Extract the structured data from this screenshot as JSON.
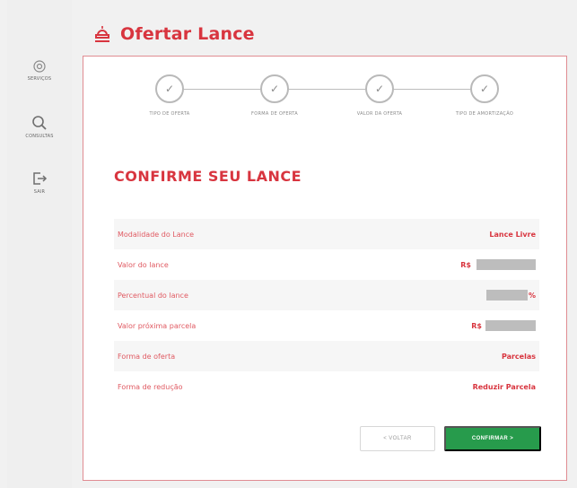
{
  "sidebar": {
    "items": [
      {
        "label": "SERVIÇOS"
      },
      {
        "label": "CONSULTAS"
      },
      {
        "label": "SAIR"
      }
    ]
  },
  "header": {
    "title": "Ofertar Lance"
  },
  "stepper": {
    "steps": [
      {
        "label": "TIPO DE OFERTA"
      },
      {
        "label": "FORMA DE OFERTA"
      },
      {
        "label": "VALOR DA OFERTA"
      },
      {
        "label": "TIPO DE AMORTIZAÇÃO"
      }
    ]
  },
  "confirm": {
    "title": "CONFIRME SEU LANCE",
    "rows": [
      {
        "label": "Modalidade do Lance",
        "value": "Lance Livre"
      },
      {
        "label": "Valor do lance",
        "prefix": "R$"
      },
      {
        "label": "Percentual do lance",
        "suffix": "%"
      },
      {
        "label": "Valor próxima parcela",
        "prefix": "R$"
      },
      {
        "label": "Forma de oferta",
        "value": "Parcelas"
      },
      {
        "label": "Forma de redução",
        "value": "Reduzir Parcela"
      }
    ]
  },
  "buttons": {
    "back_label": "< VOLTAR",
    "confirm_label": "CONFIRMAR >"
  },
  "colors": {
    "brand": "#d8353f",
    "confirm": "#279b4c"
  }
}
